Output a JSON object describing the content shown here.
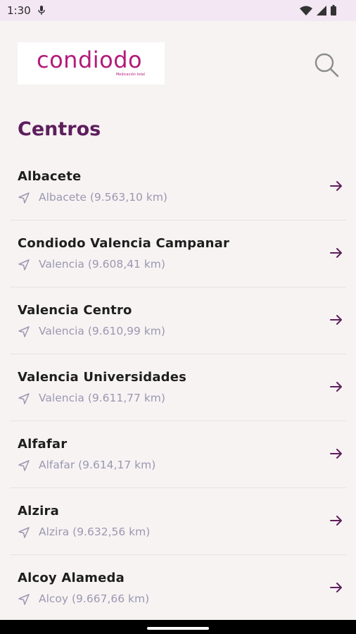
{
  "status_bar": {
    "time": "1:30"
  },
  "header": {
    "logo_text": "condiodo",
    "logo_sub": "Medicación total",
    "search_icon": "search-icon"
  },
  "page": {
    "title": "Centros"
  },
  "centers": [
    {
      "name": "Albacete",
      "location": "Albacete (9.563,10 km)"
    },
    {
      "name": "Condiodo Valencia Campanar",
      "location": "Valencia (9.608,41 km)"
    },
    {
      "name": "Valencia Centro",
      "location": "Valencia (9.610,99 km)"
    },
    {
      "name": "Valencia Universidades",
      "location": "Valencia (9.611,77 km)"
    },
    {
      "name": "Alfafar",
      "location": "Alfafar (9.614,17 km)"
    },
    {
      "name": "Alzira",
      "location": "Alzira (9.632,56 km)"
    },
    {
      "name": "Alcoy Alameda",
      "location": "Alcoy (9.667,66 km)"
    }
  ],
  "colors": {
    "brand": "#b31a7a",
    "title": "#5e1e5c",
    "arrow": "#5e1e5c",
    "location_text": "#9a98b0",
    "background": "#f7f3f3"
  }
}
